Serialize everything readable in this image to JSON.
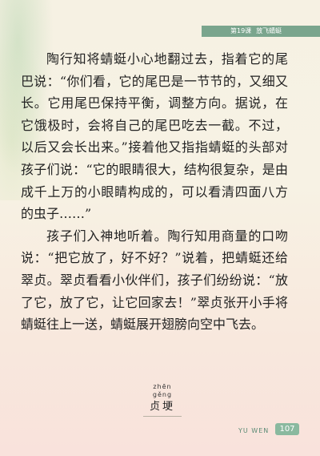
{
  "header": {
    "lesson": "第19课",
    "title": "放飞蜻蜓"
  },
  "paragraphs": [
    "陶行知将蜻蜓小心地翻过去，指着它的尾巴说：“你们看，它的尾巴是一节节的，又细又长。它用尾巴保持平衡，调整方向。据说，在它饿极时，会将自己的尾巴吃去一截。不过，以后又会长出来。”接着他又指指蜻蜓的头部对孩子们说：“它的眼睛很大，结构很复杂，是由成千上万的小眼睛构成的，可以看清四面八方的虫子……”",
    "孩子们入神地听着。陶行知用商量的口吻说：“把它放了，好不好？”说着，把蜻蜓还给翠贞。翠贞看看小伙伴们，孩子们纷纷说：“放了它，放了它，让它回家去！”翠贞张开小手将蜻蜓往上一送，蜻蜓展开翅膀向空中飞去。"
  ],
  "vocab": {
    "pinyin": "zhēn gěng",
    "word": "贞埂"
  },
  "footer": {
    "label": "YU WEN",
    "page_number": "107"
  }
}
